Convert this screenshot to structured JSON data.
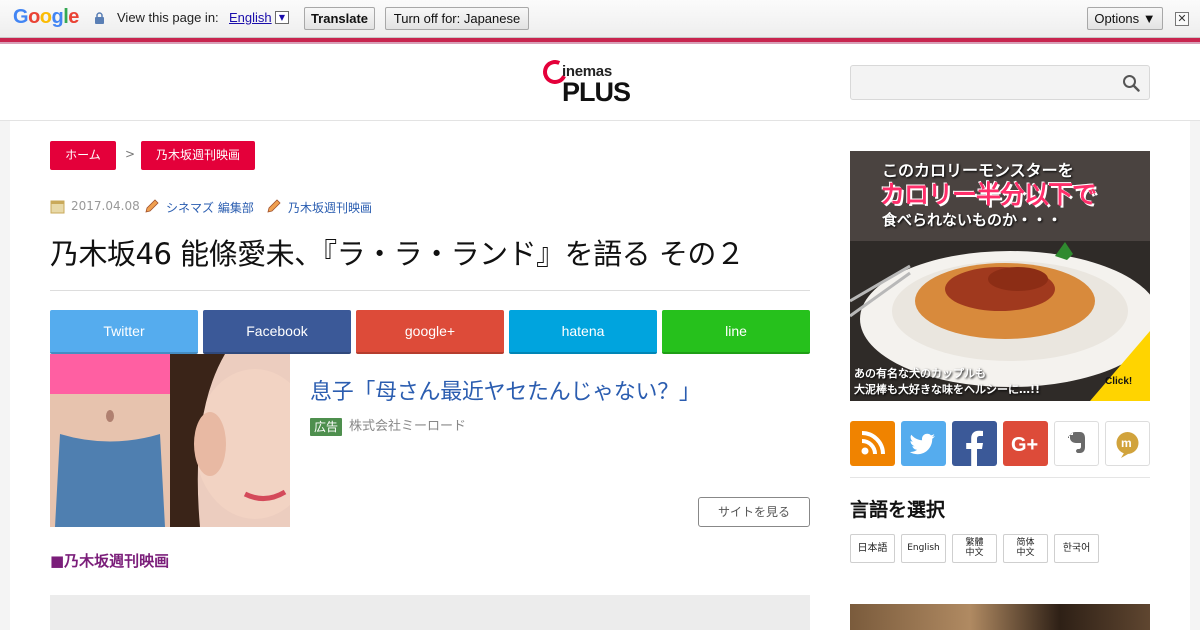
{
  "translate_bar": {
    "view_page_in": "View this page in:",
    "language": "English",
    "language_arrow": "▼",
    "translate_button": "Translate",
    "turn_off_button": "Turn off for: Japanese",
    "options_button": "Options ▼",
    "close": "✕"
  },
  "header": {
    "logo_top": "inemas",
    "logo_bottom": "PLUS",
    "search": {
      "value": "",
      "placeholder": ""
    }
  },
  "breadcrumb": {
    "home": "ホーム",
    "separator": ">",
    "category": "乃木坂週刊映画"
  },
  "meta": {
    "date": "2017.04.08",
    "author": "シネマズ 編集部",
    "category": "乃木坂週刊映画"
  },
  "article": {
    "title": "乃木坂46 能條愛未、『ラ・ラ・ランド』を語る その２",
    "section_label": "■乃木坂週刊映画"
  },
  "share_buttons": [
    {
      "label": "Twitter",
      "color": "#55acee"
    },
    {
      "label": "Facebook",
      "color": "#3b5998"
    },
    {
      "label": "google+",
      "color": "#dd4b39"
    },
    {
      "label": "hatena",
      "color": "#00a4de"
    },
    {
      "label": "line",
      "color": "#26c11c"
    }
  ],
  "ad": {
    "title": "息子「母さん最近ヤセたんじゃない？」",
    "badge": "広告",
    "sponsor": "株式会社ミーロード",
    "cta": "サイトを見る"
  },
  "sidebar": {
    "banner": {
      "line1": "このカロリーモンスターを",
      "line2": "カロリー半分以下で",
      "line3": "食べられないものか・・・",
      "foot1": "あの有名な犬のカップルも",
      "foot2": "大泥棒も大好きな味をヘルシーに…!!",
      "click": "Click!"
    },
    "social_icons": [
      {
        "name": "rss-icon",
        "color": "#f08300"
      },
      {
        "name": "twitter-icon",
        "color": "#55acee"
      },
      {
        "name": "facebook-icon",
        "color": "#3b5998"
      },
      {
        "name": "google-plus-icon",
        "color": "#dd4b39"
      },
      {
        "name": "evernote-icon",
        "color": "#ffffff"
      },
      {
        "name": "mixi-icon",
        "color": "#ffffff"
      }
    ],
    "language_heading": "言語を選択",
    "languages": [
      "日本語",
      "English",
      "繁體中文",
      "简体中文",
      "한국어"
    ]
  },
  "colors": {
    "accent": "#e4003a",
    "link": "#2b5db0",
    "section": "#7b1e7a"
  }
}
